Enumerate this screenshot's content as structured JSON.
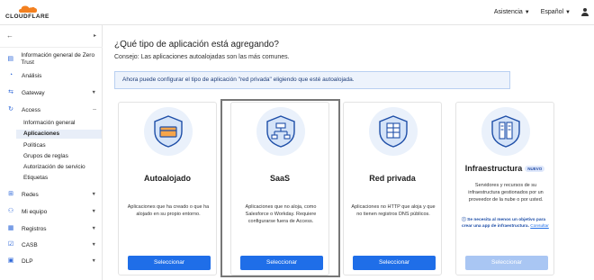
{
  "brand": {
    "logo_text": "CLOUDFLARE",
    "accent": "#1f6ee8",
    "logo_orange": "#f38020"
  },
  "topbar": {
    "help_label": "Asistencia",
    "language_label": "Español",
    "user_icon": "user-icon"
  },
  "sidebar": {
    "items": [
      {
        "label": "Información general de Zero Trust",
        "icon": "overview-icon"
      },
      {
        "label": "Análisis",
        "icon": "analytics-icon"
      },
      {
        "label": "Gateway",
        "icon": "gateway-icon"
      },
      {
        "label": "Access",
        "icon": "access-icon"
      },
      {
        "label": "Redes",
        "icon": "networks-icon"
      },
      {
        "label": "Mi equipo",
        "icon": "my-team-icon"
      },
      {
        "label": "Registros",
        "icon": "logs-icon"
      },
      {
        "label": "CASB",
        "icon": "casb-icon"
      },
      {
        "label": "DLP",
        "icon": "dlp-icon"
      }
    ],
    "access_subitems": [
      "Información general",
      "Aplicaciones",
      "Políticas",
      "Grupos de reglas",
      "Autorización de servicio",
      "Etiquetas"
    ]
  },
  "main": {
    "heading": "¿Qué tipo de aplicación está agregando?",
    "hint": "Consejo: Las aplicaciones autoalojadas son las más comunes.",
    "banner": "Ahora puede configurar el tipo de aplicación \"red privada\" eligiendo que esté autoalojada.",
    "cards": [
      {
        "title": "Autoalojado",
        "desc": "Aplicaciones que ha creado o que ha alojado en su propio entorno.",
        "button": "Seleccionar"
      },
      {
        "title": "SaaS",
        "desc": "Aplicaciones que no aloja, como Salesforce o Workday. Requiere configurarse fuera de Access.",
        "button": "Seleccionar"
      },
      {
        "title": "Red privada",
        "desc": "Aplicaciones no HTTP que aloja y que no tienen registros DNS públicos.",
        "button": "Seleccionar"
      },
      {
        "title": "Infraestructura",
        "badge": "NUEVO",
        "desc": "Servidores y recursos de su infraestructura gestionados por un proveedor de la nube o por usted.",
        "requirement": "Se necesita al menos un objetivo para crear una app de infraestructura.",
        "requirement_link": "Consultar",
        "button": "Seleccionar"
      }
    ]
  }
}
